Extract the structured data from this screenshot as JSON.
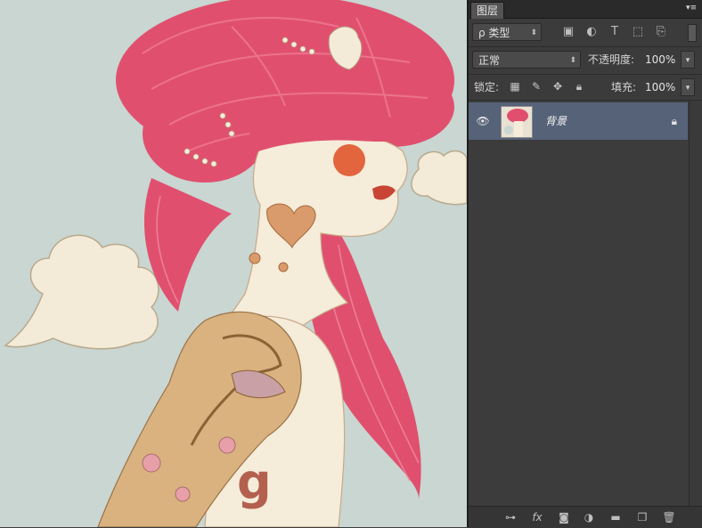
{
  "panel": {
    "tab_title": "图层",
    "menu_icon": "panel-menu-icon"
  },
  "filter": {
    "kind_label": "ρ 类型",
    "icons": [
      "image-filter-icon",
      "adjustment-filter-icon",
      "text-filter-icon",
      "shape-filter-icon",
      "smart-object-filter-icon"
    ]
  },
  "blend": {
    "mode": "正常",
    "opacity_label": "不透明度:",
    "opacity_value": "100%"
  },
  "lock": {
    "label": "锁定:",
    "fill_label": "填充:",
    "fill_value": "100%"
  },
  "layers": [
    {
      "name": "背景",
      "visible": true,
      "locked": true
    }
  ],
  "footer": {
    "icons": [
      "link-layers-icon",
      "fx-icon",
      "mask-icon",
      "adjustment-layer-icon",
      "group-folder-icon",
      "new-layer-icon",
      "delete-trash-icon"
    ]
  },
  "colors": {
    "selected_layer": "#566278",
    "panel_bg": "#3b3b3b",
    "canvas_bg": "#c9d6d2",
    "hair": "#e0506e"
  }
}
